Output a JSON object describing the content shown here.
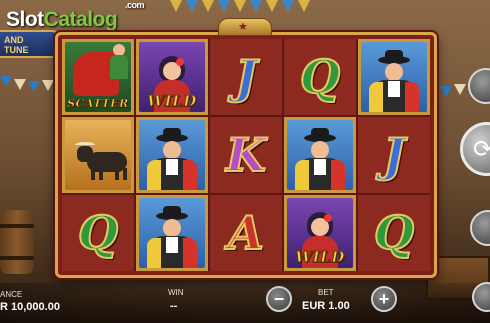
{
  "watermark": {
    "slot": "Slot",
    "catalog": "Catalog",
    "com": ".com"
  },
  "game_logo": {
    "line1": "AND",
    "line2": "TUNE"
  },
  "reels": {
    "grid": [
      [
        "scatter",
        "wild_woman",
        "J",
        "Q",
        "matador"
      ],
      [
        "bull",
        "matador",
        "K",
        "matador",
        "J"
      ],
      [
        "Q",
        "matador",
        "A",
        "wild_woman",
        "Q"
      ]
    ],
    "labels": {
      "scatter": "SCATTER",
      "wild": "WILD"
    }
  },
  "bottom_bar": {
    "balance_label": "ANCE",
    "balance_value": "R 10,000.00",
    "win_label": "WIN",
    "win_value": "--",
    "bet_label": "BET",
    "bet_value": "EUR 1.00",
    "bet_decrease_icon": "minus-icon",
    "bet_increase_icon": "plus-icon",
    "minus_glyph": "−",
    "plus_glyph": "+"
  },
  "side_controls": {
    "spin_icon": "spin-arrow-icon",
    "spin_glyph": "⟳"
  }
}
